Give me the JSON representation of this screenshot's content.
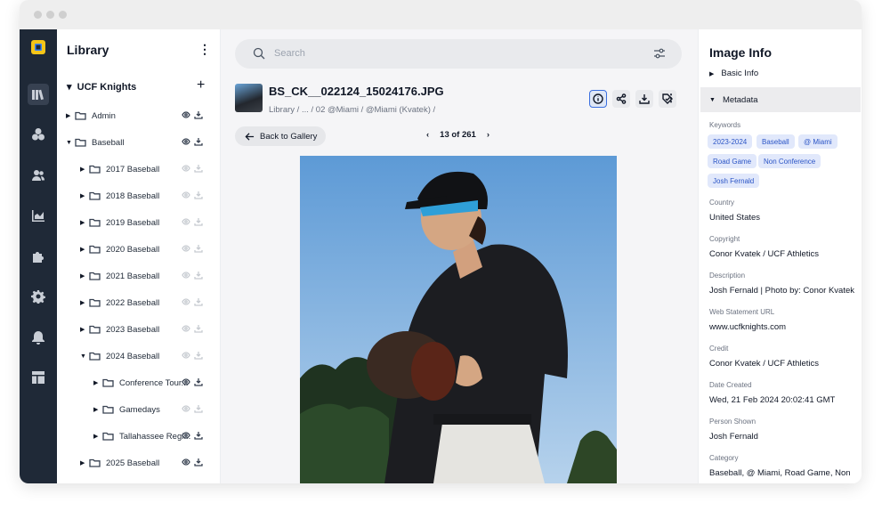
{
  "sidebar": {
    "title": "Library",
    "root": "UCF Knights",
    "items": [
      {
        "label": "Admin",
        "level": 0,
        "expanded": false,
        "active": true
      },
      {
        "label": "Baseball",
        "level": 0,
        "expanded": true,
        "active": true
      },
      {
        "label": "2017 Baseball",
        "level": 1,
        "expanded": false,
        "active": false
      },
      {
        "label": "2018 Baseball",
        "level": 1,
        "expanded": false,
        "active": false
      },
      {
        "label": "2019 Baseball",
        "level": 1,
        "expanded": false,
        "active": false
      },
      {
        "label": "2020 Baseball",
        "level": 1,
        "expanded": false,
        "active": false
      },
      {
        "label": "2021 Baseball",
        "level": 1,
        "expanded": false,
        "active": false
      },
      {
        "label": "2022 Baseball",
        "level": 1,
        "expanded": false,
        "active": false
      },
      {
        "label": "2023 Baseball",
        "level": 1,
        "expanded": false,
        "active": false
      },
      {
        "label": "2024 Baseball",
        "level": 1,
        "expanded": true,
        "active": false
      },
      {
        "label": "Conference Tour...",
        "level": 2,
        "expanded": false,
        "active": true
      },
      {
        "label": "Gamedays",
        "level": 2,
        "expanded": false,
        "active": false
      },
      {
        "label": "Tallahassee Regi...",
        "level": 2,
        "expanded": false,
        "active": true
      },
      {
        "label": "2025 Baseball",
        "level": 1,
        "expanded": false,
        "active": true
      }
    ]
  },
  "search": {
    "placeholder": "Search"
  },
  "asset": {
    "filename": "BS_CK__022124_15024176.JPG",
    "breadcrumb": "Library / ... / 02 @Miami / @Miami (Kvatek) /"
  },
  "gallery": {
    "back_label": "Back to Gallery",
    "position": "13 of 261"
  },
  "info": {
    "title": "Image Info",
    "basic_label": "Basic Info",
    "metadata_label": "Metadata",
    "keywords_label": "Keywords",
    "keywords": [
      "2023-2024",
      "Baseball",
      "@ Miami",
      "Road Game",
      "Non Conference",
      "Josh Fernald"
    ],
    "fields": [
      {
        "label": "Country",
        "value": "United States"
      },
      {
        "label": "Copyright",
        "value": "Conor Kvatek / UCF Athletics"
      },
      {
        "label": "Description",
        "value": "Josh Fernald | Photo by: Conor Kvatek"
      },
      {
        "label": "Web Statement URL",
        "value": "www.ucfknights.com"
      },
      {
        "label": "Credit",
        "value": "Conor Kvatek / UCF Athletics"
      },
      {
        "label": "Date Created",
        "value": "Wed, 21 Feb 2024 20:02:41 GMT"
      },
      {
        "label": "Person Shown",
        "value": "Josh Fernald"
      },
      {
        "label": "Category",
        "value": "Baseball, @ Miami, Road Game, Non"
      }
    ]
  },
  "colors": {
    "accent": "#3b6fe0",
    "rail": "#1f2937",
    "tag_bg": "#e1e8fb",
    "tag_text": "#2b55c6"
  }
}
